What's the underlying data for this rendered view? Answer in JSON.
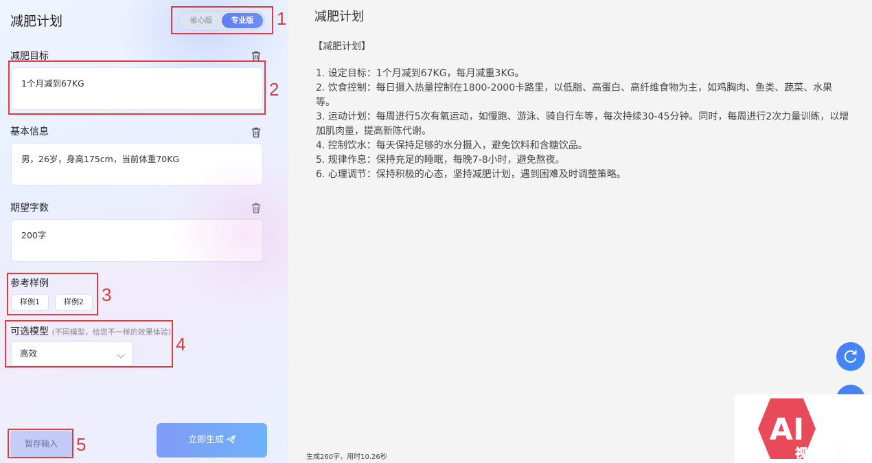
{
  "left": {
    "title": "减肥计划",
    "versions": {
      "basic": "省心版",
      "pro": "专业版"
    },
    "goal": {
      "label": "减肥目标",
      "value": "1个月减到67KG"
    },
    "info": {
      "label": "基本信息",
      "value": "男，26岁，身高175cm，当前体重70KG"
    },
    "words": {
      "label": "期望字数",
      "value": "200字"
    },
    "examples": {
      "label": "参考样例",
      "items": [
        "样例1",
        "样例2"
      ]
    },
    "model": {
      "label": "可选模型",
      "sub": "(不同模型，给您不一样的效果体验)",
      "selected": "高效"
    },
    "save_label": "暂存输入",
    "generate_label": "立即生成"
  },
  "callouts": [
    "1",
    "2",
    "3",
    "4",
    "5"
  ],
  "right": {
    "title": "减肥计划",
    "heading": "【减肥计划】",
    "lines": [
      "1. 设定目标：1个月减到67KG，每月减重3KG。",
      "2. 饮食控制：每日摄入热量控制在1800-2000卡路里，以低脂、高蛋白、高纤维食物为主，如鸡胸肉、鱼类、蔬菜、水果等。",
      "3. 运动计划：每周进行5次有氧运动，如慢跑、游泳、骑自行车等，每次持续30-45分钟。同时，每周进行2次力量训练，以增加肌肉量，提高新陈代谢。",
      "4. 控制饮水：每天保持足够的水分摄入，避免饮料和含糖饮品。",
      "5. 规律作息：保持充足的睡眠，每晚7-8小时，避免熬夜。",
      "6. 心理调节：保持积极的心态，坚持减肥计划，遇到困难及时调整策略。"
    ],
    "status": "生成260字，用时10.26秒"
  },
  "watermark": {
    "text_top": "AI",
    "text_bottom": "视频贴吧"
  }
}
